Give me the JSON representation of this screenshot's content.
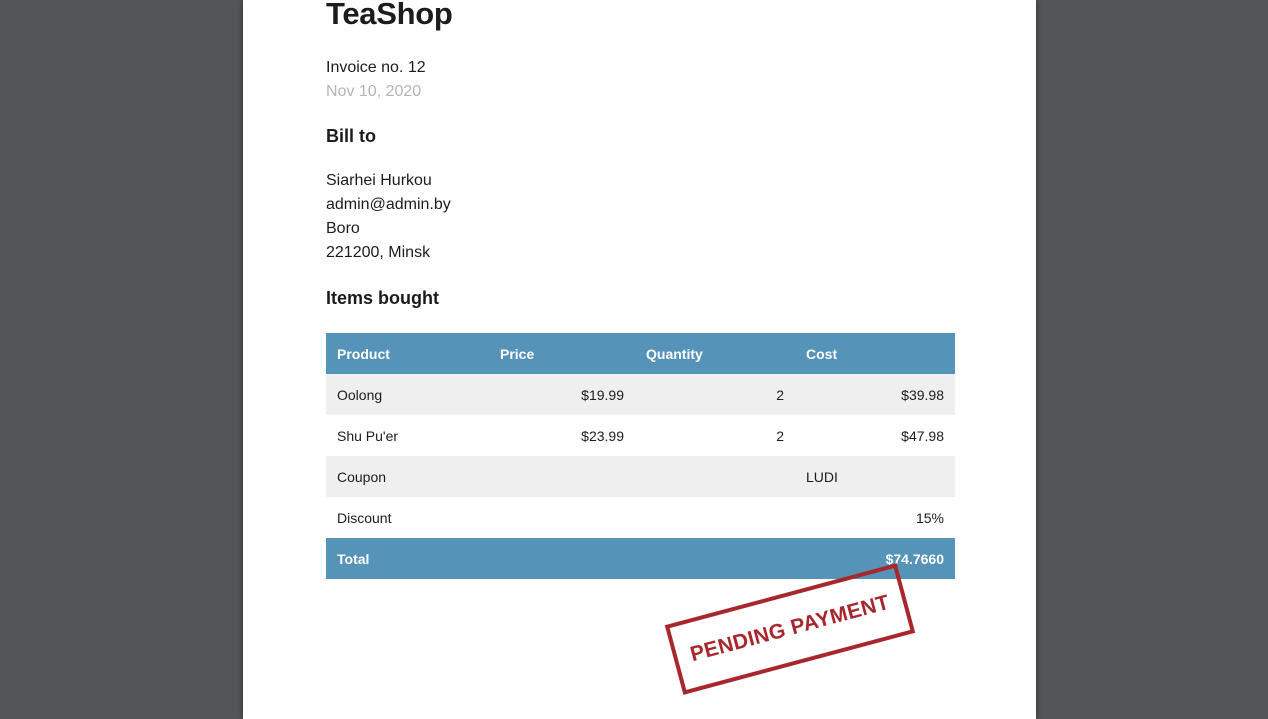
{
  "shop": {
    "name": "TeaShop"
  },
  "invoice": {
    "number_label": "Invoice no. 12",
    "date": "Nov 10, 2020"
  },
  "bill_to": {
    "heading": "Bill to",
    "name": "Siarhei Hurkou",
    "email": "admin@admin.by",
    "address_line": "Boro",
    "city_line": "221200, Minsk"
  },
  "items_section": {
    "heading": "Items bought",
    "columns": [
      "Product",
      "Price",
      "Quantity",
      "Cost"
    ],
    "rows": [
      {
        "product": "Oolong",
        "price": "$19.99",
        "quantity": "2",
        "cost": "$39.98"
      },
      {
        "product": "Shu Pu'er",
        "price": "$23.99",
        "quantity": "2",
        "cost": "$47.98"
      }
    ],
    "coupon": {
      "label": "Coupon",
      "value": "LUDI"
    },
    "discount": {
      "label": "Discount",
      "value": "15%"
    },
    "total": {
      "label": "Total",
      "value": "$74.7660"
    }
  },
  "stamp": {
    "text": "PENDING PAYMENT",
    "color": "#a8272d"
  },
  "colors": {
    "table_header": "#5594b8",
    "row_shade": "#efefef",
    "viewer_background": "#525659"
  }
}
